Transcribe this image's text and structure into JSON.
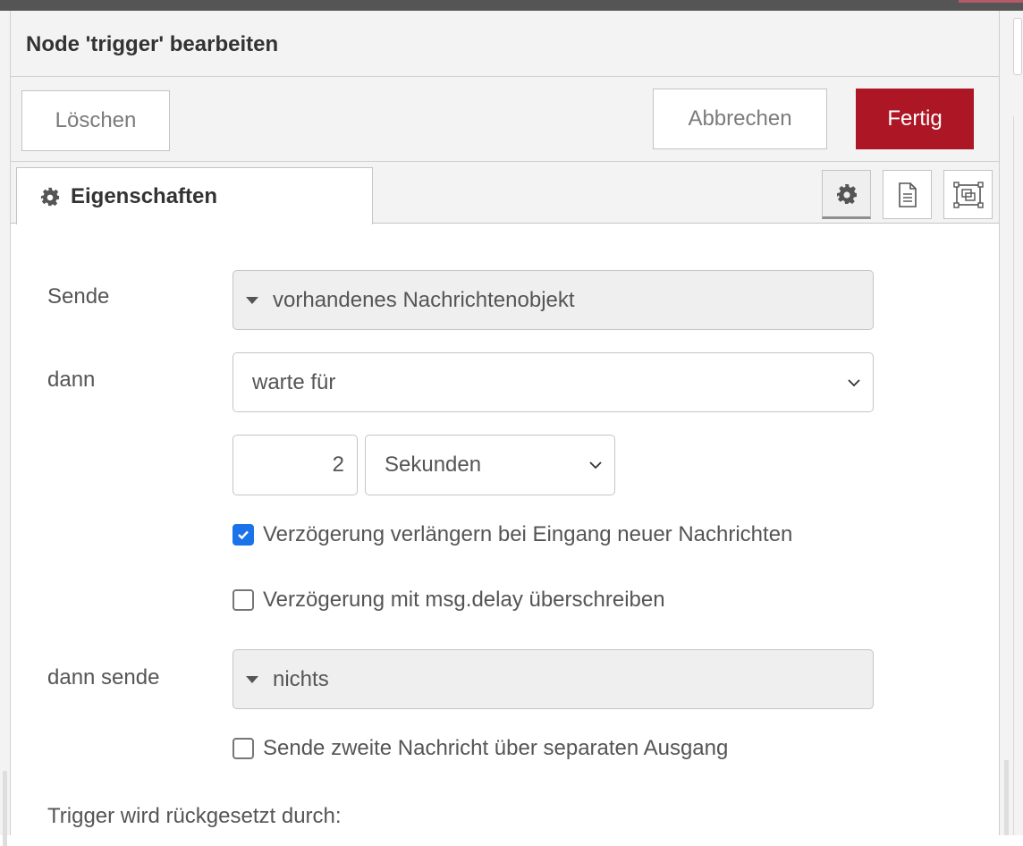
{
  "header": {
    "title": "Node 'trigger' bearbeiten"
  },
  "toolbar": {
    "delete_label": "Löschen",
    "cancel_label": "Abbrechen",
    "done_label": "Fertig",
    "done_color": "#ad1625"
  },
  "tabs": {
    "active_label": "Eigenschaften",
    "active_icon": "gear-icon",
    "buttons": [
      "gear-icon",
      "description-icon",
      "appearance-icon"
    ]
  },
  "form": {
    "send": {
      "label": "Sende",
      "value": "vorhandenes Nachrichtenobjekt"
    },
    "then": {
      "label": "dann",
      "value": "warte für"
    },
    "delay": {
      "value": "2",
      "unit": "Sekunden"
    },
    "extend_delay": {
      "label": "Verzögerung verlängern bei Eingang neuer Nachrichten",
      "checked": true
    },
    "override_delay": {
      "label": "Verzögerung mit msg.delay überschreiben",
      "checked": false
    },
    "then_send": {
      "label": "dann sende",
      "value": "nichts"
    },
    "second_output": {
      "label": "Sende zweite Nachricht über separaten Ausgang",
      "checked": false
    },
    "reset_label": "Trigger wird rückgesetzt durch:"
  }
}
